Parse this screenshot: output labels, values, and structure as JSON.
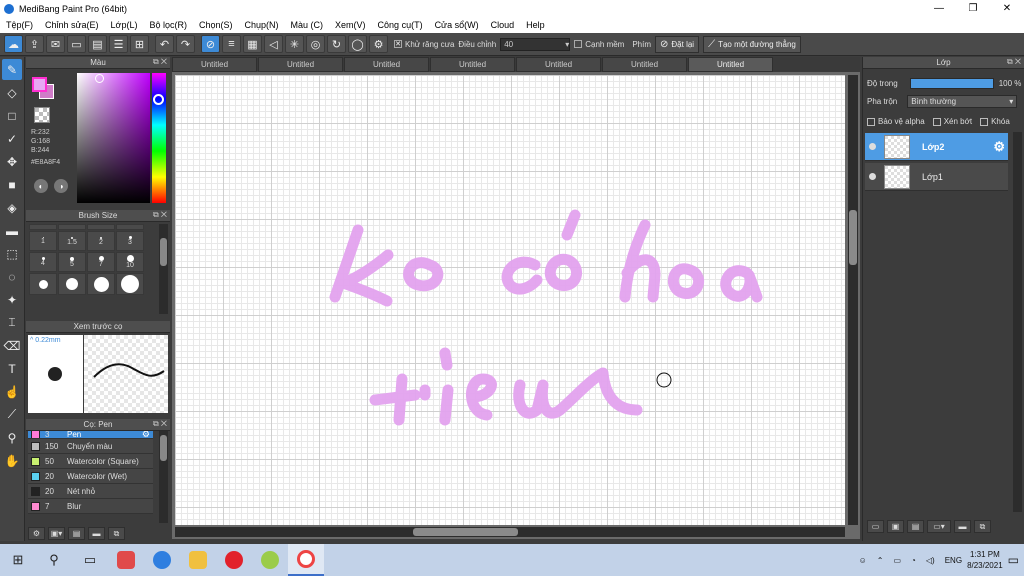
{
  "window": {
    "title": "MediBang Paint Pro (64bit)",
    "minimize": "—",
    "maximize": "❐",
    "close": "✕"
  },
  "menu": [
    "Tệp(F)",
    "Chỉnh sửa(E)",
    "Lớp(L)",
    "Bộ lọc(R)",
    "Chọn(S)",
    "Chụp(N)",
    "Màu (C)",
    "Xem(V)",
    "Công cụ(T)",
    "Cửa sổ(W)",
    "Cloud",
    "Help"
  ],
  "toolbar": {
    "antialias_label": "Khử răng cưa",
    "adjust_label": "Điều chỉnh",
    "adjust_value": "40",
    "edge_label": "Cạnh mềm",
    "key_label": "Phím",
    "reset_label": "Đặt lại",
    "straight_label": "Tạo một đường thẳng"
  },
  "color_panel": {
    "title": "Màu",
    "r": "R:232",
    "g": "G:168",
    "b": "B:244",
    "hex": "#E8A8F4",
    "fg_color": "#E8A8F4"
  },
  "brush_size": {
    "title": "Brush Size",
    "labels": [
      "1",
      "1.5",
      "2",
      "3",
      "4",
      "5",
      "7",
      "10"
    ]
  },
  "brush_preview": {
    "title": "Xem trước cọ",
    "size": "0.22mm"
  },
  "pen_panel": {
    "title": "Cọ: Pen",
    "items": [
      {
        "num": "3",
        "name": "Pen",
        "color": "#ff7ad8"
      },
      {
        "num": "150",
        "name": "Chuyển màu",
        "color": "#bbbbbb"
      },
      {
        "num": "50",
        "name": "Watercolor (Square)",
        "color": "#c8f070"
      },
      {
        "num": "20",
        "name": "Watercolor (Wet)",
        "color": "#5ad0f0"
      },
      {
        "num": "20",
        "name": "Nét nhỏ",
        "color": "#222222"
      },
      {
        "num": "7",
        "name": "Blur",
        "color": "#ff8ad0"
      }
    ]
  },
  "tabs": [
    "Untitled",
    "Untitled",
    "Untitled",
    "Untitled",
    "Untitled",
    "Untitled",
    "Untitled"
  ],
  "layer_panel": {
    "title": "Lớp",
    "opacity_label": "Độ trong",
    "opacity_value": "100 %",
    "blend_label": "Pha trộn",
    "blend_value": "Bình thường",
    "protect_alpha": "Bảo vệ alpha",
    "clipping": "Xén bớt",
    "lock": "Khóa",
    "layers": [
      {
        "name": "Lớp2",
        "selected": true
      },
      {
        "name": "Lớp1",
        "selected": false
      }
    ]
  },
  "canvas": {
    "stroke_color": "#e3a3ef"
  },
  "taskbar": {
    "lang": "ENG",
    "time": "1:31 PM",
    "date": "8/23/2021"
  }
}
